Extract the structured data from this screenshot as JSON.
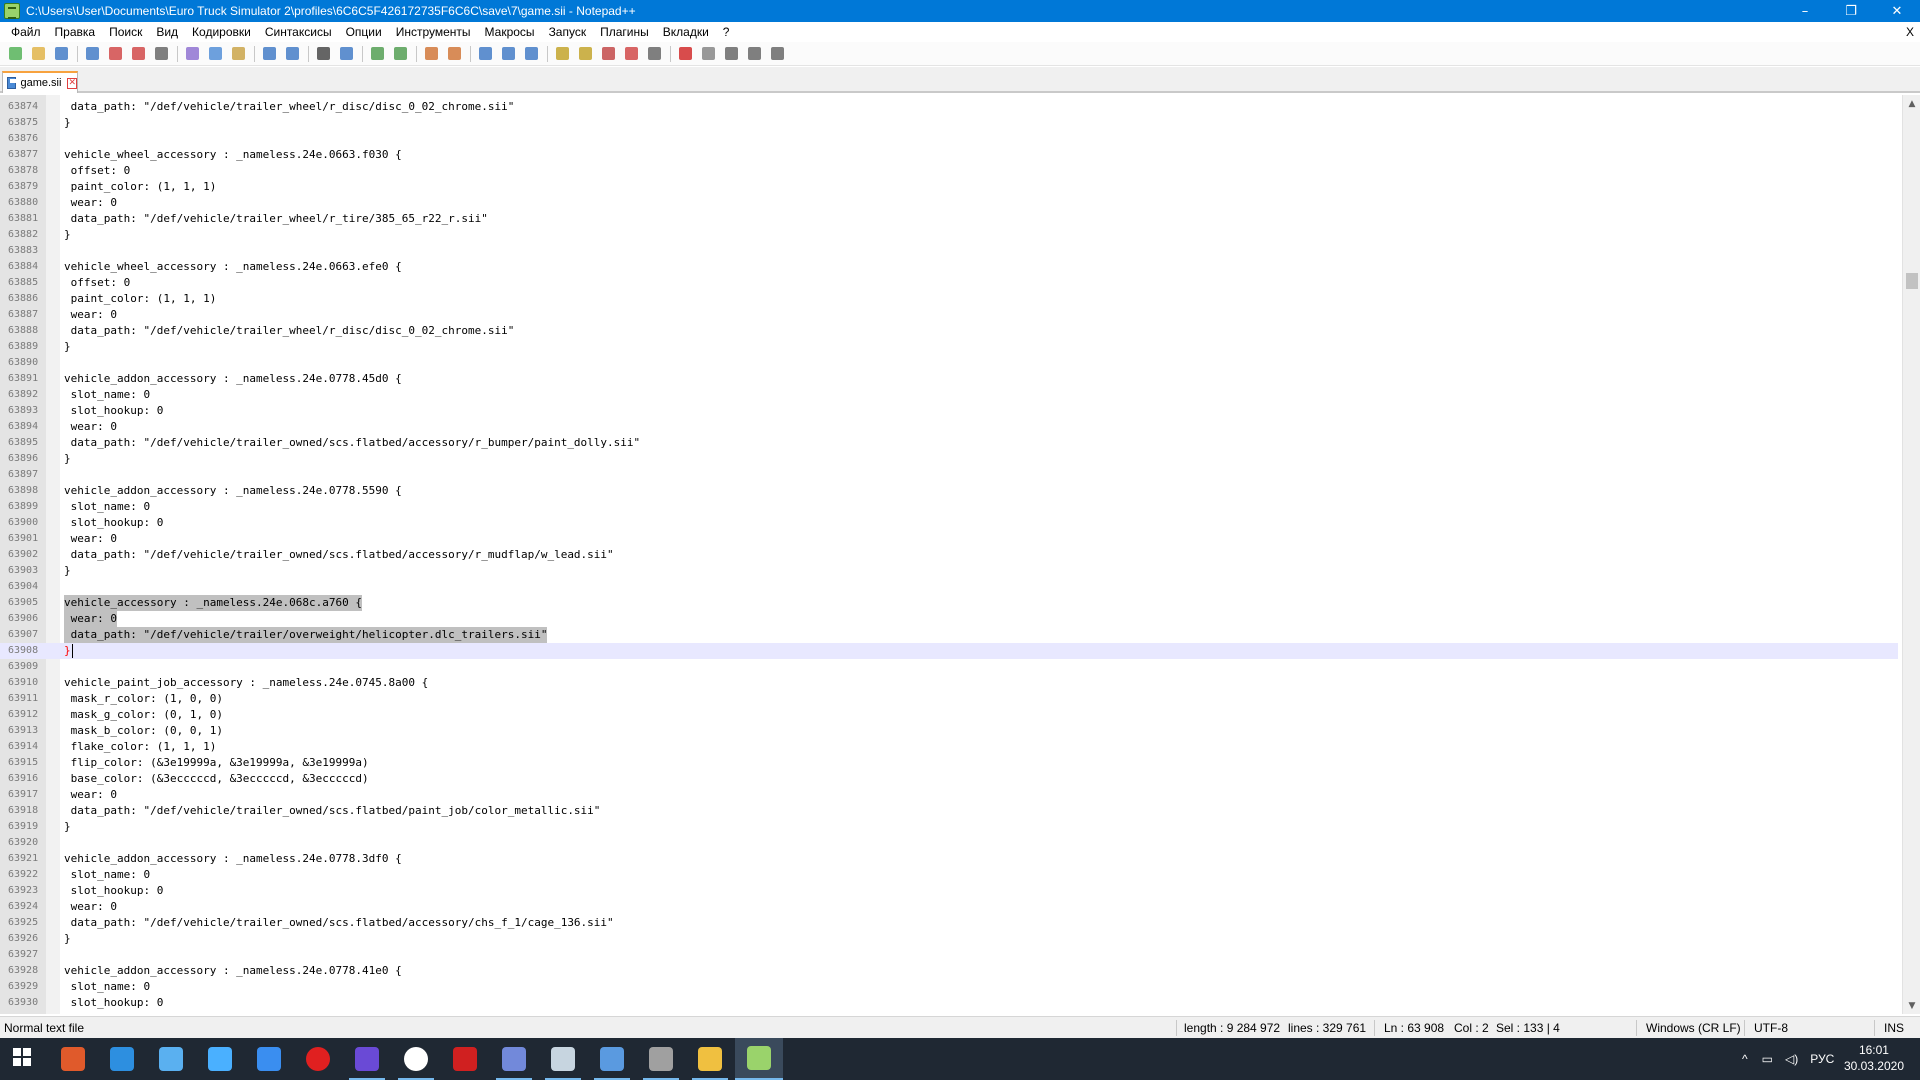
{
  "window": {
    "title": "C:\\Users\\User\\Documents\\Euro Truck Simulator 2\\profiles\\6C6C5F426172735F6C6C\\save\\7\\game.sii - Notepad++",
    "minimize_label": "–",
    "maximize_label": "❐",
    "close_label": "✕"
  },
  "menu": {
    "items": [
      "Файл",
      "Правка",
      "Поиск",
      "Вид",
      "Кодировки",
      "Синтаксисы",
      "Опции",
      "Инструменты",
      "Макросы",
      "Запуск",
      "Плагины",
      "Вкладки",
      "?"
    ],
    "close_document_label": "X"
  },
  "toolbar": {
    "icons": [
      "new-file-icon",
      "open-file-icon",
      "save-icon",
      "save-all-icon",
      "close-icon",
      "close-all-icon",
      "print-icon",
      "cut-icon",
      "copy-icon",
      "paste-icon",
      "undo-icon",
      "redo-icon",
      "find-icon",
      "replace-icon",
      "zoom-in-icon",
      "zoom-out-icon",
      "sync-vertical-icon",
      "sync-horizontal-icon",
      "word-wrap-icon",
      "show-all-chars-icon",
      "indent-guide-icon",
      "udl-icon",
      "doc-map-icon",
      "function-list-icon",
      "folder-workspace-icon",
      "monitor-icon",
      "record-macro-icon",
      "stop-macro-icon",
      "play-macro-icon",
      "run-macro-multiple-icon",
      "save-macro-icon"
    ]
  },
  "tab": {
    "label": "game.sii",
    "close_label": "✕"
  },
  "editor": {
    "lines": [
      {
        "n": "63874",
        "text": " data_path: \"/def/vehicle/trailer_wheel/r_disc/disc_0_02_chrome.sii\""
      },
      {
        "n": "63875",
        "text": "}"
      },
      {
        "n": "63876",
        "text": ""
      },
      {
        "n": "63877",
        "text": "vehicle_wheel_accessory : _nameless.24e.0663.f030 {"
      },
      {
        "n": "63878",
        "text": " offset: 0"
      },
      {
        "n": "63879",
        "text": " paint_color: (1, 1, 1)"
      },
      {
        "n": "63880",
        "text": " wear: 0"
      },
      {
        "n": "63881",
        "text": " data_path: \"/def/vehicle/trailer_wheel/r_tire/385_65_r22_r.sii\""
      },
      {
        "n": "63882",
        "text": "}"
      },
      {
        "n": "63883",
        "text": ""
      },
      {
        "n": "63884",
        "text": "vehicle_wheel_accessory : _nameless.24e.0663.efe0 {"
      },
      {
        "n": "63885",
        "text": " offset: 0"
      },
      {
        "n": "63886",
        "text": " paint_color: (1, 1, 1)"
      },
      {
        "n": "63887",
        "text": " wear: 0"
      },
      {
        "n": "63888",
        "text": " data_path: \"/def/vehicle/trailer_wheel/r_disc/disc_0_02_chrome.sii\""
      },
      {
        "n": "63889",
        "text": "}"
      },
      {
        "n": "63890",
        "text": ""
      },
      {
        "n": "63891",
        "text": "vehicle_addon_accessory : _nameless.24e.0778.45d0 {"
      },
      {
        "n": "63892",
        "text": " slot_name: 0"
      },
      {
        "n": "63893",
        "text": " slot_hookup: 0"
      },
      {
        "n": "63894",
        "text": " wear: 0"
      },
      {
        "n": "63895",
        "text": " data_path: \"/def/vehicle/trailer_owned/scs.flatbed/accessory/r_bumper/paint_dolly.sii\""
      },
      {
        "n": "63896",
        "text": "}"
      },
      {
        "n": "63897",
        "text": ""
      },
      {
        "n": "63898",
        "text": "vehicle_addon_accessory : _nameless.24e.0778.5590 {"
      },
      {
        "n": "63899",
        "text": " slot_name: 0"
      },
      {
        "n": "63900",
        "text": " slot_hookup: 0"
      },
      {
        "n": "63901",
        "text": " wear: 0"
      },
      {
        "n": "63902",
        "text": " data_path: \"/def/vehicle/trailer_owned/scs.flatbed/accessory/r_mudflap/w_lead.sii\""
      },
      {
        "n": "63903",
        "text": "}"
      },
      {
        "n": "63904",
        "text": ""
      },
      {
        "n": "63905",
        "text": "vehicle_accessory : _nameless.24e.068c.a760 {",
        "selected": true
      },
      {
        "n": "63906",
        "text": " wear: 0",
        "selected": true
      },
      {
        "n": "63907",
        "text": " data_path: \"/def/vehicle/trailer/overweight/helicopter.dlc_trailers.sii\"",
        "selected": true
      },
      {
        "n": "63908",
        "text": "}",
        "current": true,
        "brace": true
      },
      {
        "n": "63909",
        "text": ""
      },
      {
        "n": "63910",
        "text": "vehicle_paint_job_accessory : _nameless.24e.0745.8a00 {"
      },
      {
        "n": "63911",
        "text": " mask_r_color: (1, 0, 0)"
      },
      {
        "n": "63912",
        "text": " mask_g_color: (0, 1, 0)"
      },
      {
        "n": "63913",
        "text": " mask_b_color: (0, 0, 1)"
      },
      {
        "n": "63914",
        "text": " flake_color: (1, 1, 1)"
      },
      {
        "n": "63915",
        "text": " flip_color: (&3e19999a, &3e19999a, &3e19999a)"
      },
      {
        "n": "63916",
        "text": " base_color: (&3ecccccd, &3ecccccd, &3ecccccd)"
      },
      {
        "n": "63917",
        "text": " wear: 0"
      },
      {
        "n": "63918",
        "text": " data_path: \"/def/vehicle/trailer_owned/scs.flatbed/paint_job/color_metallic.sii\""
      },
      {
        "n": "63919",
        "text": "}"
      },
      {
        "n": "63920",
        "text": ""
      },
      {
        "n": "63921",
        "text": "vehicle_addon_accessory : _nameless.24e.0778.3df0 {"
      },
      {
        "n": "63922",
        "text": " slot_name: 0"
      },
      {
        "n": "63923",
        "text": " slot_hookup: 0"
      },
      {
        "n": "63924",
        "text": " wear: 0"
      },
      {
        "n": "63925",
        "text": " data_path: \"/def/vehicle/trailer_owned/scs.flatbed/accessory/chs_f_1/cage_136.sii\""
      },
      {
        "n": "63926",
        "text": "}"
      },
      {
        "n": "63927",
        "text": ""
      },
      {
        "n": "63928",
        "text": "vehicle_addon_accessory : _nameless.24e.0778.41e0 {"
      },
      {
        "n": "63929",
        "text": " slot_name: 0"
      },
      {
        "n": "63930",
        "text": " slot_hookup: 0"
      }
    ],
    "scroll_position": 0.58
  },
  "status": {
    "file_type": "Normal text file",
    "length": "length : 9 284 972",
    "lines": "lines : 329 761",
    "ln": "Ln : 63 908",
    "col": "Col : 2",
    "sel": "Sel : 133 | 4",
    "eol": "Windows (CR LF)",
    "encoding": "UTF-8",
    "mode": "INS"
  },
  "taskbar": {
    "apps": [
      {
        "name": "windows-start-icon",
        "color": "#ffffff"
      },
      {
        "name": "power-app-icon",
        "color": "#e05a2b"
      },
      {
        "name": "refresh-app-icon",
        "color": "#2d8fe0"
      },
      {
        "name": "monitor-app-icon",
        "color": "#5ab0f0"
      },
      {
        "name": "network-app-icon",
        "color": "#4ab0ff"
      },
      {
        "name": "remote-app-icon",
        "color": "#3a8ef0"
      },
      {
        "name": "record-app-icon",
        "color": "#e02020"
      },
      {
        "name": "floppy-app-icon",
        "color": "#6a4ad6"
      },
      {
        "name": "yandex-browser-icon",
        "color": "#ffffff"
      },
      {
        "name": "red-app-icon",
        "color": "#d02020"
      },
      {
        "name": "discord-icon",
        "color": "#7289da"
      },
      {
        "name": "steam-icon",
        "color": "#c7d5e0"
      },
      {
        "name": "truck-app-icon",
        "color": "#5a9ae0"
      },
      {
        "name": "game-app-icon",
        "color": "#a0a0a0"
      },
      {
        "name": "file-explorer-icon",
        "color": "#f0c040"
      },
      {
        "name": "notepadpp-icon",
        "color": "#9ad36b"
      }
    ],
    "tray_chevron": "^",
    "lang": "РУС",
    "time": "16:01",
    "date": "30.03.2020"
  }
}
